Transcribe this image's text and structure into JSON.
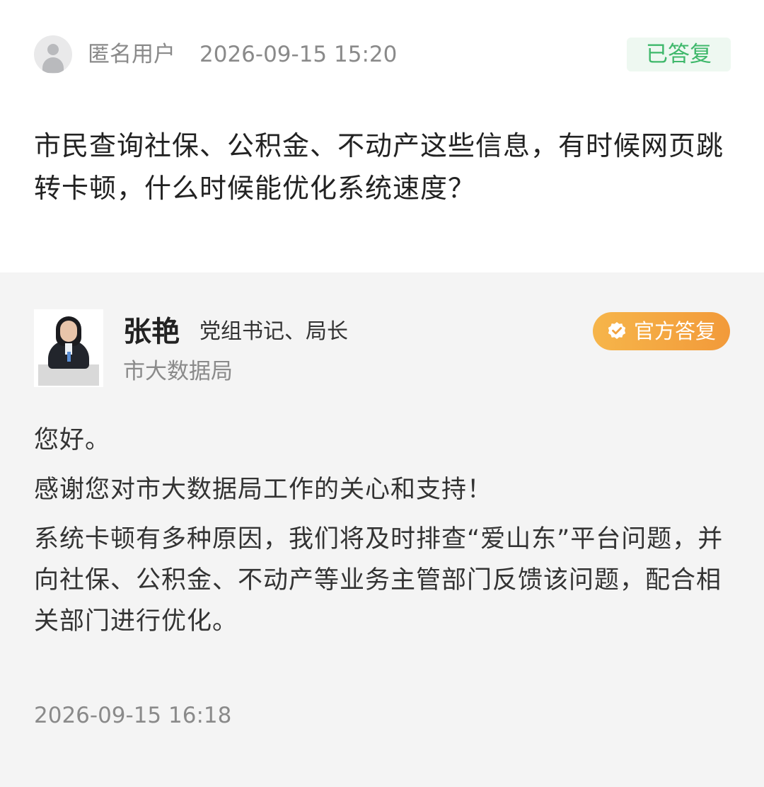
{
  "question": {
    "user": "匿名用户",
    "time": "2026-09-15 15:20",
    "status": "已答复",
    "text": "市民查询社保、公积金、不动产这些信息，有时候网页跳转卡顿，什么时候能优化系统速度？"
  },
  "answer": {
    "name": "张艳",
    "title": "党组书记、局长",
    "department": "市大数据局",
    "badge": "官方答复",
    "paragraphs": [
      "您好。",
      "感谢您对市大数据局工作的关心和支持！",
      "系统卡顿有多种原因，我们将及时排查“爱山东”平台问题，并向社保、公积金、不动产等业务主管部门反馈该问题，配合相关部门进行优化。"
    ],
    "time": "2026-09-15 16:18"
  },
  "colors": {
    "status_green": "#3fb86b",
    "badge_orange": "#f29a3a",
    "answer_background": "#f4f4f4"
  },
  "icons": {
    "question_avatar": "default-user-avatar-icon",
    "official_badge": "verified-check-icon"
  }
}
